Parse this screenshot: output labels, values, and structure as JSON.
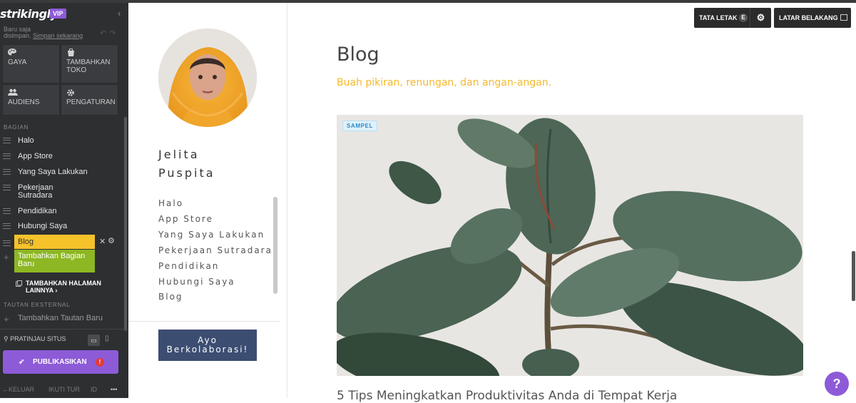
{
  "editor": {
    "brand": "strikingly",
    "badge": "VIP",
    "saved_line1": "Baru saja",
    "saved_line2": "disimpan.",
    "save_link": "Simpan sekarang",
    "tiles": [
      {
        "icon": "palette-icon",
        "label": "GAYA"
      },
      {
        "icon": "store-icon",
        "label": "TAMBAHKAN TOKO"
      },
      {
        "icon": "audience-icon",
        "label": "AUDIENS"
      },
      {
        "icon": "gear-icon",
        "label": "PENGATURAN"
      }
    ],
    "sections_label": "BAGIAN",
    "sections": [
      "Halo",
      "App Store",
      "Yang Saya Lakukan",
      "Pekerjaan Sutradara",
      "Pendidikan",
      "Hubungi Saya"
    ],
    "active_section": "Blog",
    "add_section": "Tambahkan Bagian Baru",
    "more_pages": "TAMBAHKAN HALAMAN LAINNYA",
    "external_label": "TAUTAN EKSTERNAL",
    "add_external": "Tambahkan Tautan Baru",
    "preview": "PRATINJAU SITUS",
    "publish": "PUBLIKASIKAN",
    "footer": {
      "exit": "KELUAR",
      "tour": "IKUTI TUR",
      "lang": "ID",
      "more": "•••"
    }
  },
  "profile": {
    "name_line1": "Jelita",
    "name_line2": "Puspita",
    "nav": [
      "Halo",
      "App Store",
      "Yang Saya Lakukan",
      "Pekerjaan Sutradara",
      "Pendidikan",
      "Hubungi Saya",
      "Blog"
    ],
    "cta_line1": "Ayo",
    "cta_line2": "Berkolaborasi!"
  },
  "main": {
    "layout_button": "TATA LETAK",
    "layout_variant": "E",
    "background_button": "LATAR BELAKANG",
    "title": "Blog",
    "subtitle": "Buah pikiran, renungan, dan angan-angan.",
    "sample_badge": "SAMPEL",
    "post_title": "5 Tips Meningkatkan Produktivitas Anda di Tempat Kerja",
    "help": "?"
  },
  "colors": {
    "sidebar": "#2e2f31",
    "accent_purple": "#8d5bd7",
    "active_yellow": "#f5c22a",
    "add_green": "#8db723",
    "subtitle_gold": "#f4b82c",
    "cta_navy": "#3c4d72"
  }
}
